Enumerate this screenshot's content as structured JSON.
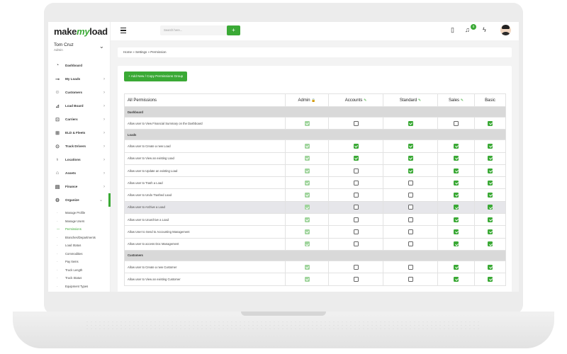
{
  "brand": {
    "logo_make": "make",
    "logo_my": "my",
    "logo_load": "load",
    "accent": "#3aa935"
  },
  "user": {
    "name": "Tom Cruz",
    "role": "Admin"
  },
  "sidebar": {
    "items": [
      {
        "label": "Dashboard",
        "icon": "dashboard-icon",
        "glyph": "◔",
        "arrow": ""
      },
      {
        "label": "My Loads",
        "icon": "truck-icon",
        "glyph": "⊸",
        "arrow": "›"
      },
      {
        "label": "Customers",
        "icon": "customers-icon",
        "glyph": "☺",
        "arrow": "›"
      },
      {
        "label": "Load Board",
        "icon": "chart-icon",
        "glyph": "⊿",
        "arrow": "›"
      },
      {
        "label": "Carriers",
        "icon": "carrier-icon",
        "glyph": "⊡",
        "arrow": "›"
      },
      {
        "label": "ELD & Fleets",
        "icon": "fleet-icon",
        "glyph": "⊞",
        "arrow": "›"
      },
      {
        "label": "Track Drivers",
        "icon": "location-pin-icon",
        "glyph": "⊙",
        "arrow": "›"
      },
      {
        "label": "Locations",
        "icon": "map-pin-icon",
        "glyph": "♁",
        "arrow": "›"
      },
      {
        "label": "Assets",
        "icon": "bag-icon",
        "glyph": "⌂",
        "arrow": "›"
      },
      {
        "label": "Finance",
        "icon": "wallet-icon",
        "glyph": "▤",
        "arrow": "›"
      },
      {
        "label": "Organize",
        "icon": "gear-icon",
        "glyph": "⚙",
        "arrow": "⌄"
      }
    ],
    "sub_items": [
      "Manage Profile",
      "Manage Users",
      "Permissions",
      "Branches/Departments",
      "Load Status",
      "Commodities",
      "Pay Items",
      "Truck Length",
      "Truck Status",
      "Equipment Types"
    ]
  },
  "topbar": {
    "search_placeholder": "Search here...",
    "search_button": "+",
    "notification_count": "0"
  },
  "breadcrumb": "Home  »  Settings  »  Permission",
  "add_button": "+  Add New / Copy Permissions Group",
  "table": {
    "headers": [
      "All Permissions",
      "Admin",
      "Accounts",
      "Standard",
      "Sales",
      "Basic"
    ],
    "rows": [
      {
        "type": "section",
        "label": "Dashboard"
      },
      {
        "type": "row",
        "label": "Allow user to View Financial Summary on the Dashboard",
        "values": [
          "dis",
          "off",
          "on",
          "off",
          "on"
        ]
      },
      {
        "type": "section",
        "label": "Loads"
      },
      {
        "type": "row",
        "label": "Allow user to Create a new Load",
        "values": [
          "dis",
          "on",
          "on",
          "on",
          "on"
        ]
      },
      {
        "type": "row",
        "label": "Allow user to View an existing Load",
        "values": [
          "dis",
          "on",
          "on",
          "on",
          "on"
        ]
      },
      {
        "type": "row",
        "label": "Allow user to Update an existing Load",
        "values": [
          "dis",
          "off",
          "on",
          "on",
          "on"
        ]
      },
      {
        "type": "row",
        "label": "Allow user to Trash a Load",
        "values": [
          "dis",
          "off",
          "off",
          "on",
          "on"
        ]
      },
      {
        "type": "row",
        "label": "Allow user to Undo Trashed Load",
        "values": [
          "dis",
          "off",
          "off",
          "on",
          "on"
        ]
      },
      {
        "type": "row",
        "label": "Allow user to Archive a Load",
        "values": [
          "dis",
          "off",
          "off",
          "on",
          "on"
        ],
        "highlight": true
      },
      {
        "type": "row",
        "label": "Allow user to Unarchive a Load",
        "values": [
          "dis",
          "off",
          "off",
          "on",
          "on"
        ]
      },
      {
        "type": "row",
        "label": "Allow User to Send to Accounting Management",
        "values": [
          "dis",
          "off",
          "off",
          "on",
          "on"
        ]
      },
      {
        "type": "row",
        "label": "Allow user to access Doc Management",
        "values": [
          "dis",
          "off",
          "off",
          "on",
          "on"
        ]
      },
      {
        "type": "section",
        "label": "Customers"
      },
      {
        "type": "row",
        "label": "Allow user to Create a new Customer",
        "values": [
          "dis",
          "off",
          "off",
          "on",
          "on"
        ]
      },
      {
        "type": "row",
        "label": "Allow user to View an existing Customer",
        "values": [
          "dis",
          "off",
          "off",
          "on",
          "on"
        ]
      }
    ]
  }
}
